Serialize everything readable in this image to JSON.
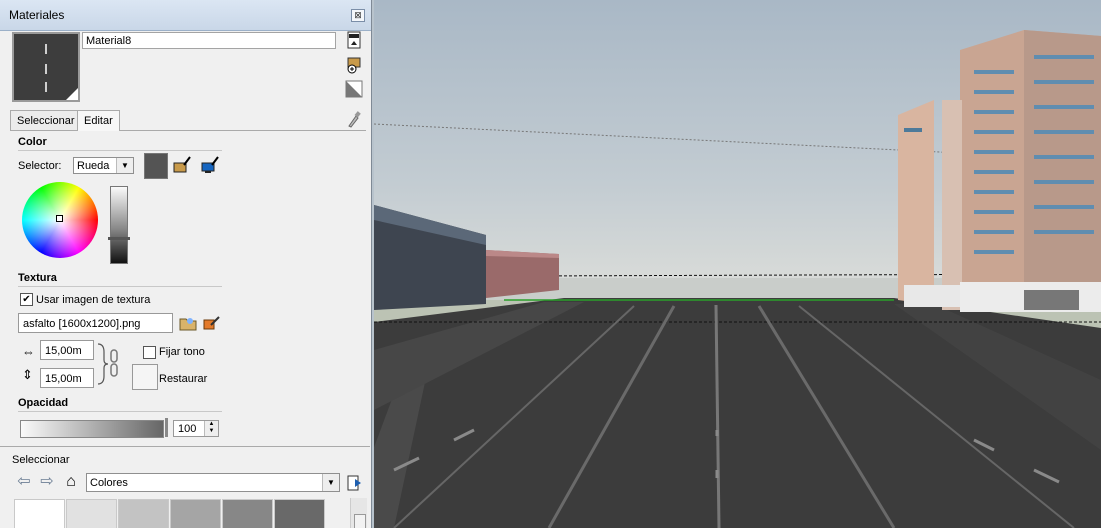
{
  "panel": {
    "title": "Materiales",
    "close_glyph": "⊠",
    "material_name": "Material8",
    "tabs": [
      {
        "label": "Seleccionar",
        "active": false
      },
      {
        "label": "Editar",
        "active": true
      }
    ],
    "color": {
      "section_label": "Color",
      "selector_label": "Selector:",
      "selector_value": "Rueda",
      "swatch_color": "#545454"
    },
    "texture": {
      "section_label": "Textura",
      "use_texture_label": "Usar imagen de textura",
      "use_texture_checked": "✔",
      "file_name": "asfalto [1600x1200].png",
      "width": "15,00m",
      "height": "15,00m",
      "width_icon": "⇔",
      "height_icon": "⇕",
      "fix_hue_label": "Fijar tono",
      "restore_label": "Restaurar"
    },
    "opacity": {
      "section_label": "Opacidad",
      "value": "100"
    },
    "bottom": {
      "header": "Seleccionar",
      "library_value": "Colores",
      "swatch_colors": [
        "#ffffff",
        "#e1e1e1",
        "#c3c3c3",
        "#a5a5a5",
        "#878787",
        "#696969"
      ]
    }
  },
  "icons": {
    "back": "⇦",
    "forward": "⇨",
    "home": "⌂"
  }
}
